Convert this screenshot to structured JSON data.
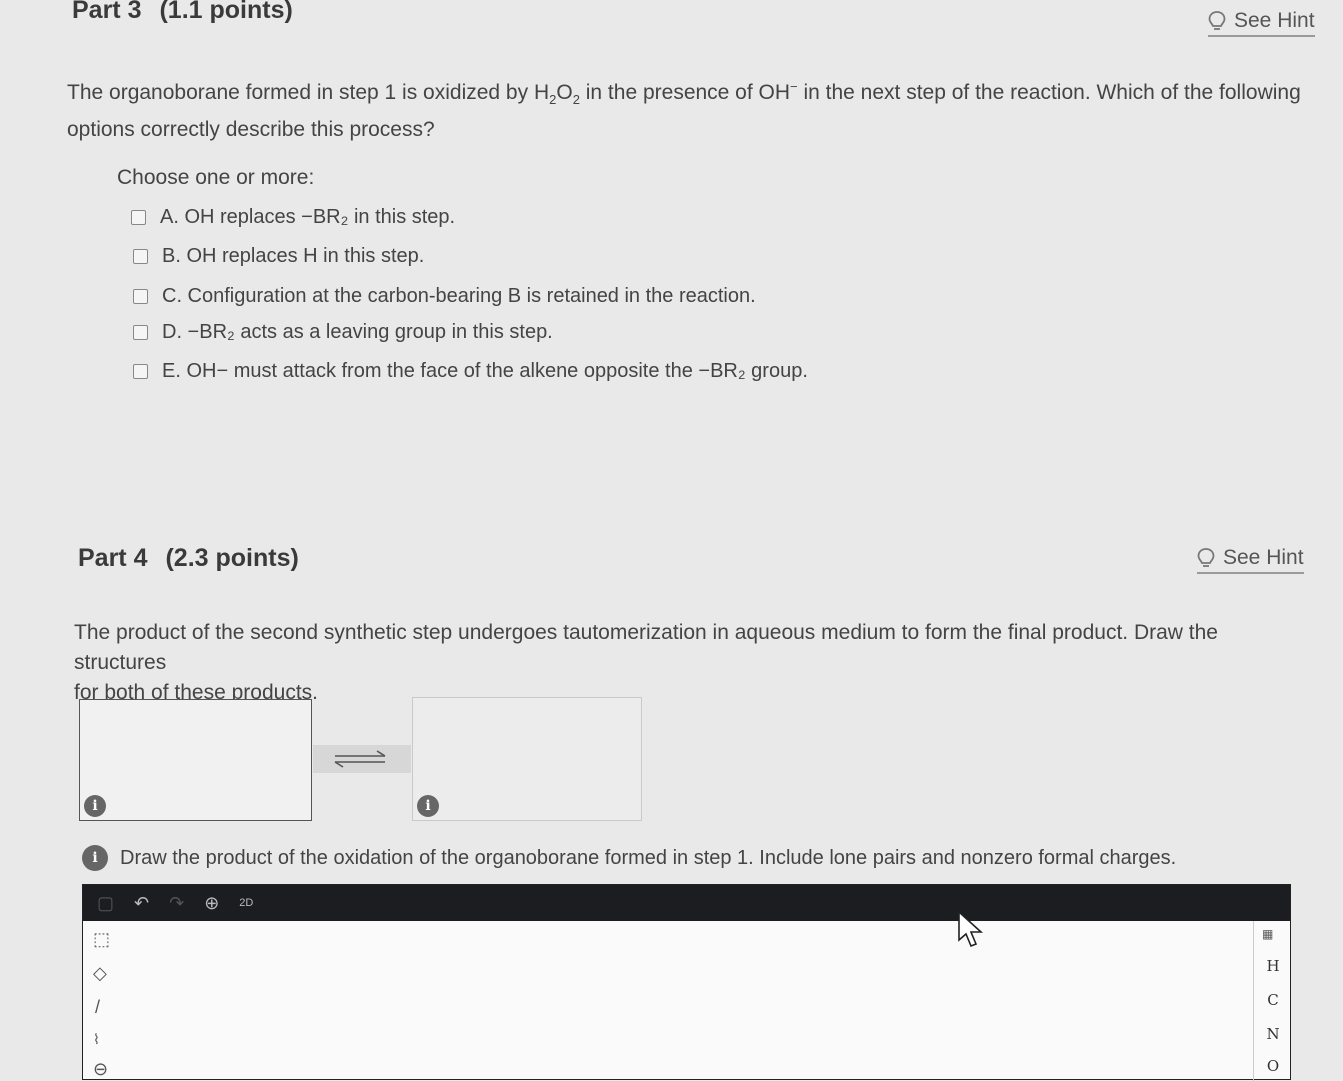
{
  "part3": {
    "label": "Part 3",
    "points": "(1.1 points)",
    "hint_label": "See Hint",
    "question_line1_a": "The organoborane formed in step 1 is oxidized by H",
    "question_sub1": "2",
    "question_line1_b": "O",
    "question_sub2": "2",
    "question_line1_c": " in the presence of OH",
    "question_sup": "−",
    "question_line1_d": " in the next step of the reaction. Which of the following",
    "question_line2": "options correctly describe this process?",
    "choose_label": "Choose one or more:",
    "options": [
      {
        "label": "A. OH replaces −BR₂ in this step."
      },
      {
        "label": "B. OH replaces H in this step."
      },
      {
        "label": "C. Configuration at the carbon-bearing B is retained in the reaction."
      },
      {
        "label": "D. −BR₂ acts as a leaving group in this step."
      },
      {
        "label": "E. OH− must attack from the face of the alkene opposite the −BR₂ group."
      }
    ]
  },
  "part4": {
    "label": "Part 4",
    "points": "(2.3 points)",
    "hint_label": "See Hint",
    "question_line1": "The product of the second synthetic step undergoes tautomerization in aqueous medium to form the final product. Draw the structures",
    "question_line2": "for both of these products.",
    "info_glyph": "i",
    "instruction": "Draw the product of the oxidation of the organoborane formed in step 1. Include lone pairs and nonzero formal charges."
  },
  "editor": {
    "toolbar_2d_label": "2D",
    "atoms": [
      "H",
      "C",
      "N",
      "O"
    ]
  }
}
